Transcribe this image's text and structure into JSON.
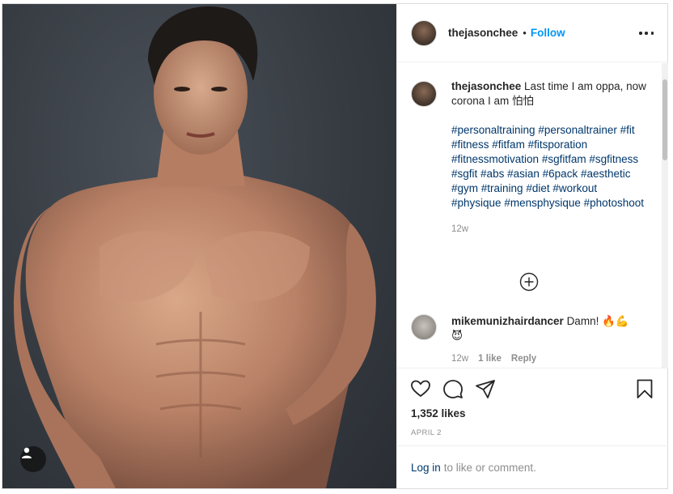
{
  "header": {
    "username": "thejasonchee",
    "separator": "•",
    "follow_label": "Follow"
  },
  "caption": {
    "username": "thejasonchee",
    "text": "Last time I am oppa, now corona I am 怕怕",
    "hashtags": [
      "#personaltraining",
      "#personaltrainer",
      "#fit",
      "#fitness",
      "#fitfam",
      "#fitsporation",
      "#fitnessmotivation",
      "#sgfitfam",
      "#sgfitness",
      "#sgfit",
      "#abs",
      "#asian",
      "#6pack",
      "#aesthetic",
      "#gym",
      "#training",
      "#diet",
      "#workout",
      "#physique",
      "#mensphysique",
      "#photoshoot"
    ],
    "time": "12w"
  },
  "comment": {
    "username": "mikemunizhairdancer",
    "text": "Damn! 🔥💪",
    "emoji_line": "😈",
    "time": "12w",
    "likes": "1 like",
    "reply": "Reply"
  },
  "actions": {
    "likes": "1,352 likes",
    "date": "APRIL 2"
  },
  "login": {
    "link": "Log in",
    "text": "to like or comment."
  },
  "icons": {
    "like": "heart-icon",
    "comment": "comment-icon",
    "share": "share-icon",
    "save": "bookmark-icon",
    "more": "more-options-icon",
    "load_more": "plus-circle-icon",
    "tagged": "user-tag-icon"
  },
  "colors": {
    "link_blue": "#0095f6",
    "hashtag": "#00376b",
    "muted": "#8e8e8e"
  }
}
